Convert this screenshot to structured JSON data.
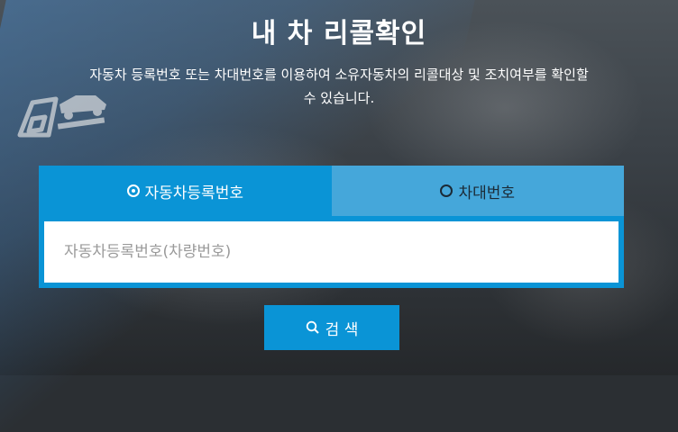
{
  "page": {
    "title": "내 차 리콜확인",
    "subtitle_line1": "자동차 등록번호 또는 차대번호를 이용하여 소유자동차의 리콜대상 및 조치여부를 확인할",
    "subtitle_line2": "수 있습니다."
  },
  "tabs": [
    {
      "label": "자동차등록번호",
      "selected": true
    },
    {
      "label": "차대번호",
      "selected": false
    }
  ],
  "search": {
    "placeholder": "자동차등록번호(차량번호)",
    "value": "",
    "button_label": "검 색"
  },
  "colors": {
    "accent": "#0a94d6",
    "tab_inactive": "#45a7da"
  },
  "icons": {
    "search": "search-icon",
    "radio_checked": "radio-checked-icon",
    "radio_unchecked": "radio-unchecked-icon",
    "logo": "car-logo"
  }
}
